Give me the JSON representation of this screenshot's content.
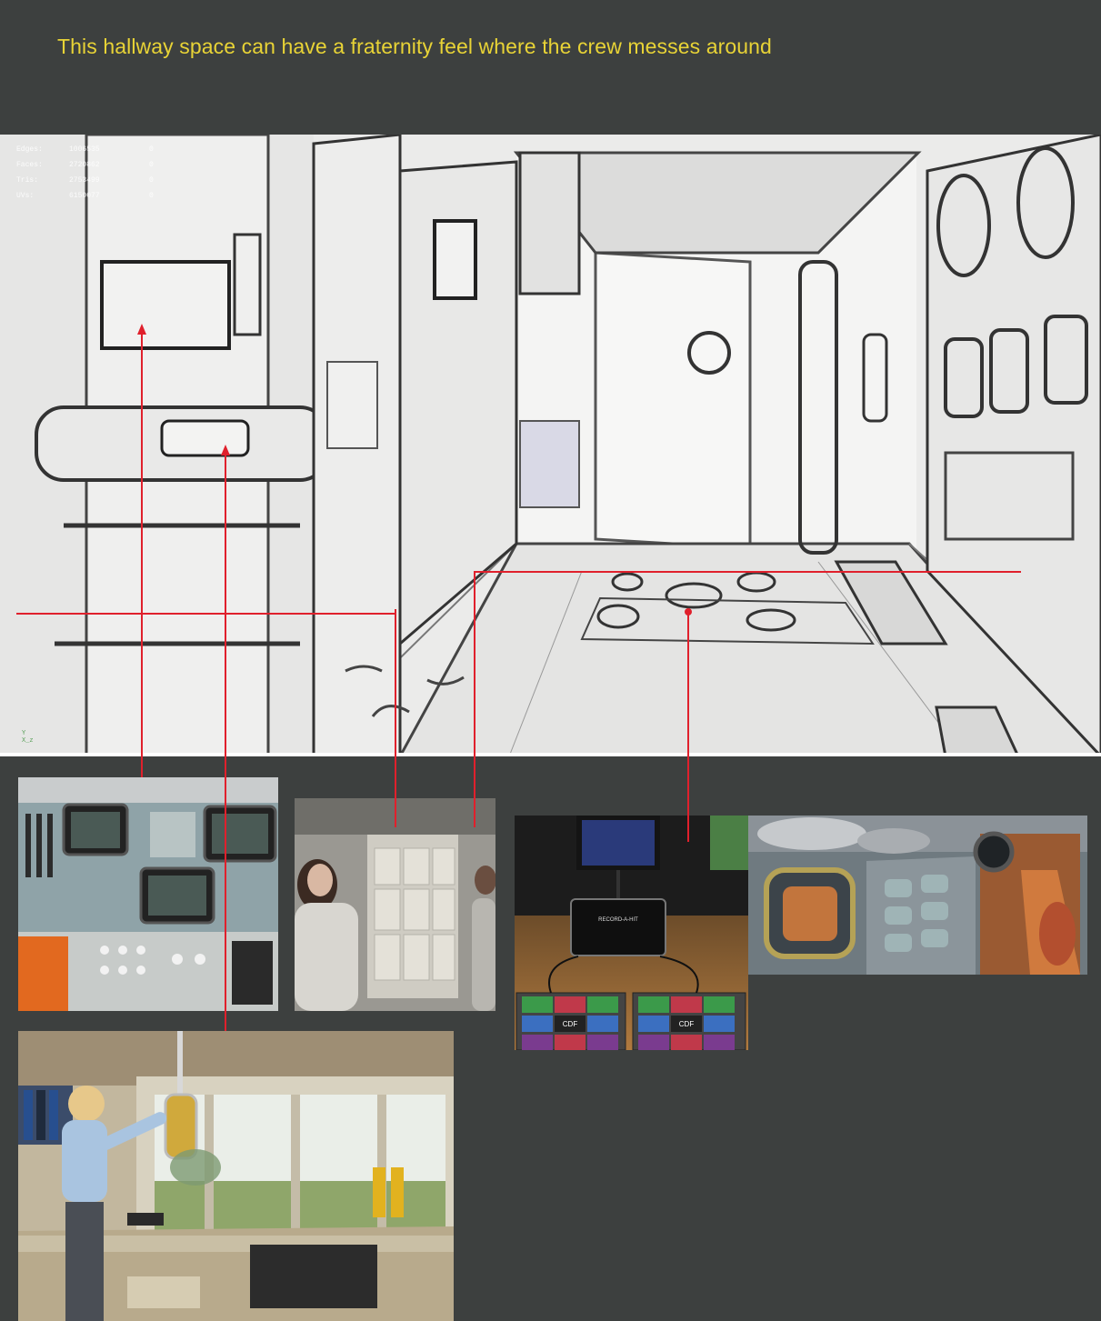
{
  "caption": "This hallway space can have a fraternity feel where the crew messes around",
  "overlay_stats": {
    "rows": [
      {
        "label": "",
        "value": "",
        "extra": ""
      },
      {
        "label": "Edges:",
        "value": "1006535",
        "extra": "0"
      },
      {
        "label": "Faces:",
        "value": "2720862",
        "extra": "0"
      },
      {
        "label": "Tris:",
        "value": "2753499",
        "extra": "0"
      },
      {
        "label": "UVs:",
        "value": "6150077",
        "extra": "0"
      }
    ]
  },
  "axis_gizmo": {
    "y": "Y",
    "xz": "X_z"
  },
  "references": {
    "dance_pad_case": "RECORD-A-HIT",
    "dance_pad_logo": "CDF"
  },
  "colors": {
    "background": "#3d403f",
    "caption": "#e8d336",
    "callout_line": "#e0202c",
    "sketch_paper": "#ebebea"
  }
}
